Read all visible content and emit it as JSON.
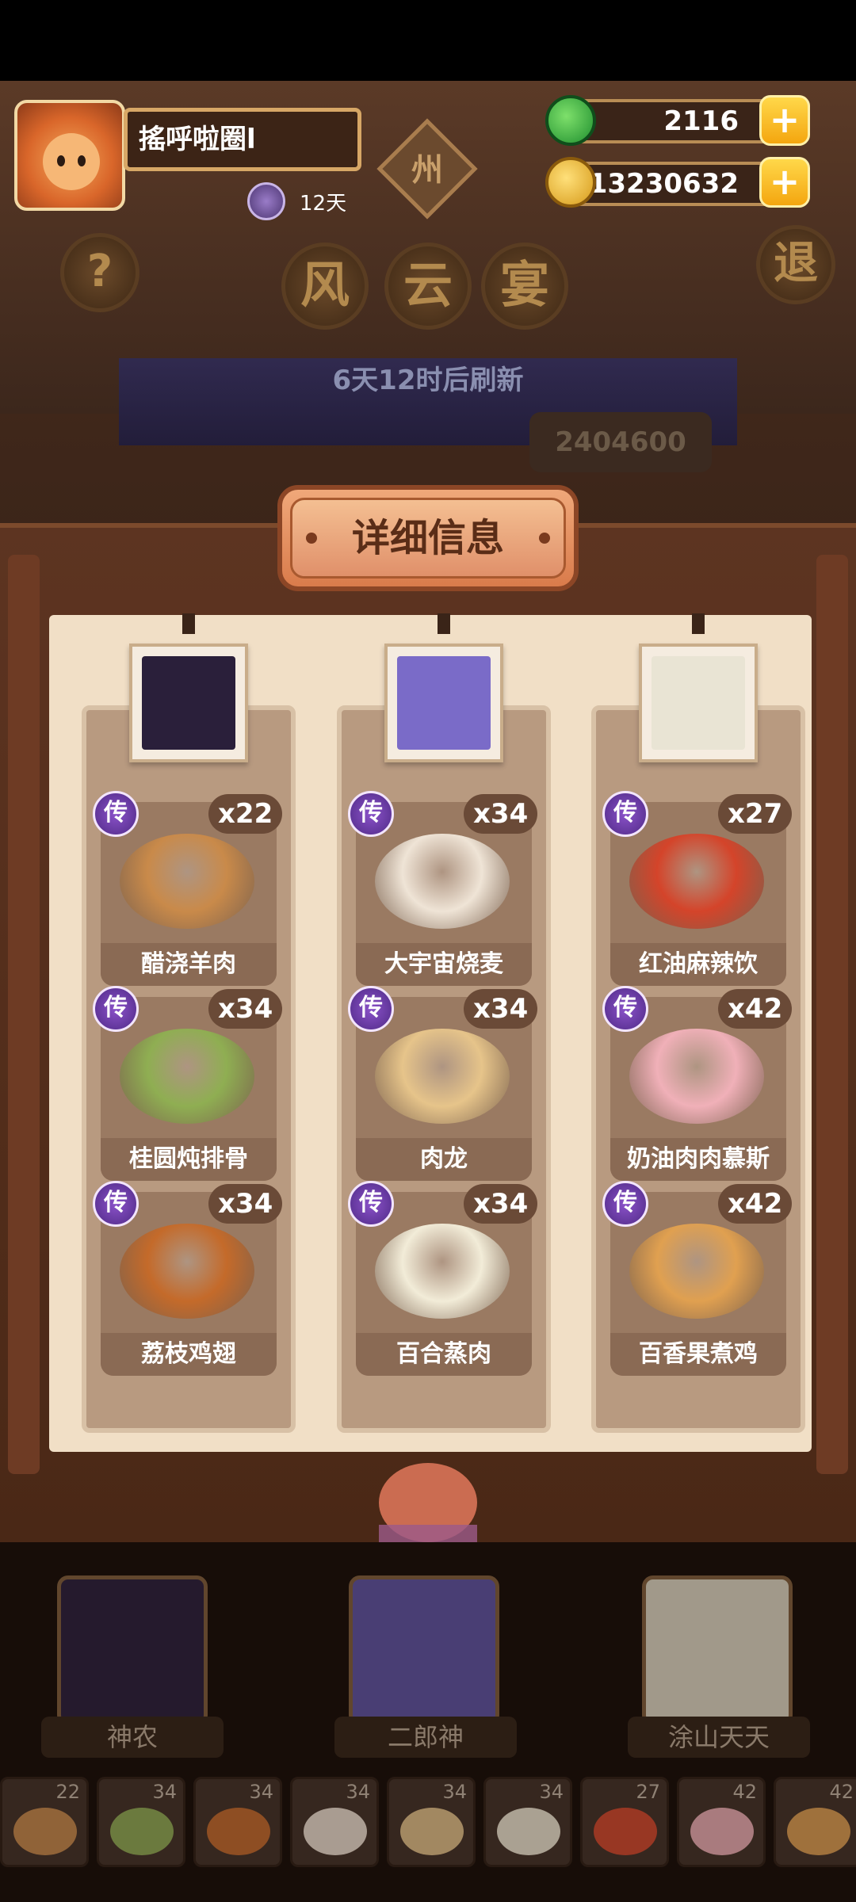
{
  "player": {
    "name": "搖呼啦圈l",
    "days": "12天"
  },
  "map_marker": "州",
  "resources": {
    "jade": "2116",
    "coins": "13230632"
  },
  "buttons": {
    "help": "?",
    "exit": "退",
    "plus": "+"
  },
  "event_title": [
    "风",
    "云",
    "宴"
  ],
  "refresh_text": "6天12时后刷新",
  "score_partial": "2404600",
  "panel": {
    "title": "详细信息",
    "columns": [
      {
        "character": "神农",
        "portrait_color": "#2a1f3a",
        "dishes": [
          {
            "name": "醋浇羊肉",
            "badge": "传",
            "count": "x22",
            "color": "#c98a4a"
          },
          {
            "name": "桂圆炖排骨",
            "badge": "传",
            "count": "x34",
            "color": "#8fae52"
          },
          {
            "name": "荔枝鸡翅",
            "badge": "传",
            "count": "x34",
            "color": "#c46a2a"
          }
        ]
      },
      {
        "character": "二郎神",
        "portrait_color": "#7a6bc8",
        "dishes": [
          {
            "name": "大宇宙烧麦",
            "badge": "传",
            "count": "x34",
            "color": "#efe4d6"
          },
          {
            "name": "肉龙",
            "badge": "传",
            "count": "x34",
            "color": "#e6c48a"
          },
          {
            "name": "百合蒸肉",
            "badge": "传",
            "count": "x34",
            "color": "#f2ecd8"
          }
        ]
      },
      {
        "character": "涂山天天",
        "portrait_color": "#e9e4d4",
        "dishes": [
          {
            "name": "红油麻辣饮",
            "badge": "传",
            "count": "x27",
            "color": "#d4442a"
          },
          {
            "name": "奶油肉肉慕斯",
            "badge": "传",
            "count": "x42",
            "color": "#f0b0b8"
          },
          {
            "name": "百香果煮鸡",
            "badge": "传",
            "count": "x42",
            "color": "#e0a050"
          }
        ]
      }
    ]
  },
  "bottom": {
    "characters": [
      "神农",
      "二郎神",
      "涂山天天"
    ],
    "tray": [
      {
        "count": "22",
        "color": "#c98a4a"
      },
      {
        "count": "34",
        "color": "#8fae52"
      },
      {
        "count": "34",
        "color": "#c46a2a"
      },
      {
        "count": "34",
        "color": "#efe4d6"
      },
      {
        "count": "34",
        "color": "#e6c48a"
      },
      {
        "count": "34",
        "color": "#f2ecd8"
      },
      {
        "count": "27",
        "color": "#d4442a"
      },
      {
        "count": "42",
        "color": "#f0b0b8"
      },
      {
        "count": "42",
        "color": "#e0a050"
      }
    ]
  }
}
